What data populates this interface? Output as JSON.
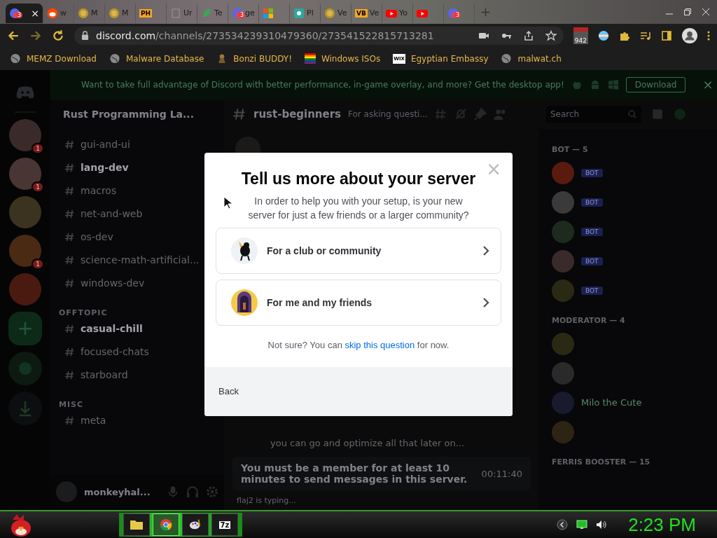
{
  "browser": {
    "tabs": [
      {
        "kind": "discord",
        "badge": "3",
        "selected": true,
        "close": "×"
      },
      {
        "kind": "reddit",
        "title": "w",
        "selected": false
      },
      {
        "kind": "coin",
        "title": "M",
        "selected": false
      },
      {
        "kind": "coin",
        "title": "M",
        "selected": false
      },
      {
        "kind": "label",
        "icon_text": "PH",
        "selected": false
      },
      {
        "kind": "plain",
        "title": "Ur",
        "selected": false
      },
      {
        "kind": "green",
        "title": "Te",
        "selected": false
      },
      {
        "kind": "discord",
        "badge": "3",
        "title": "ge",
        "selected": false
      },
      {
        "kind": "windows",
        "selected": false
      },
      {
        "kind": "teal",
        "title": "Pl",
        "selected": false
      },
      {
        "kind": "coin",
        "title": "Ve",
        "selected": false
      },
      {
        "kind": "label",
        "icon_text": "VB",
        "title": "Ve",
        "selected": false
      },
      {
        "kind": "youtube",
        "title": "Yo",
        "selected": false
      },
      {
        "kind": "youtube",
        "selected": false
      },
      {
        "kind": "discord",
        "badge": "3",
        "selected": false
      }
    ],
    "new_tab": "+",
    "address": {
      "host": "discord.com",
      "path": "/channels/273534239310479360/273541522815713281"
    },
    "extension_badge": "942",
    "bookmarks": [
      {
        "kind": "globe",
        "label": "MEMZ Download"
      },
      {
        "kind": "globe",
        "label": "Malware Database"
      },
      {
        "kind": "figure",
        "label": "Bonzi BUDDY!"
      },
      {
        "kind": "rainbow",
        "label": "Windows ISOs"
      },
      {
        "kind": "label",
        "icon_text": "WIX",
        "label": "Egyptian Embassy"
      },
      {
        "kind": "globe",
        "label": "malwat.ch"
      }
    ]
  },
  "discord": {
    "banner": {
      "text": "Want to take full advantage of Discord with better performance, in-game overlay, and more? Get the desktop app!",
      "button": "Download",
      "close": "×"
    },
    "servers": [
      {
        "color": "#3a2a2a",
        "badge": "1"
      },
      {
        "color": "#4a3535",
        "badge": "1"
      },
      {
        "color": "#3b3320"
      },
      {
        "color": "#4a2a12",
        "badge": "1"
      },
      {
        "color": "#4a1a10"
      }
    ],
    "add_server": "+",
    "server_name": "Rust Programming La...",
    "channels": [
      {
        "kind": "channel",
        "name": "gui-and-ui",
        "bold": false
      },
      {
        "kind": "channel",
        "name": "lang-dev",
        "bold": true
      },
      {
        "kind": "channel",
        "name": "macros",
        "bold": false
      },
      {
        "kind": "channel",
        "name": "net-and-web",
        "bold": false
      },
      {
        "kind": "channel",
        "name": "os-dev",
        "bold": false
      },
      {
        "kind": "channel",
        "name": "science-math-artificial...",
        "bold": false
      },
      {
        "kind": "channel",
        "name": "windows-dev",
        "bold": false
      },
      {
        "kind": "category",
        "name": "OFFTOPIC"
      },
      {
        "kind": "channel",
        "name": "casual-chill",
        "bold": true
      },
      {
        "kind": "channel",
        "name": "focused-chats",
        "bold": false
      },
      {
        "kind": "channel",
        "name": "starboard",
        "bold": false
      },
      {
        "kind": "category",
        "name": "MISC"
      },
      {
        "kind": "channel",
        "name": "meta",
        "bold": false
      }
    ],
    "user": {
      "name": "monkeyhal..."
    },
    "chat": {
      "channel": "rust-beginners",
      "topic": "For asking questi...",
      "search": {
        "placeholder": "Search"
      },
      "message": "you can go and optimize all that later on...",
      "notice": "You must be a member for at least 10 minutes to send messages in this server.",
      "timer": "00:11:40",
      "typing": "flaj2 is typing..."
    },
    "member_groups": [
      {
        "title": "BOT — 5",
        "members": [
          {
            "color": "#5a1a10",
            "tag": "BOT"
          },
          {
            "color": "#3a3a3a",
            "tag": "BOT"
          },
          {
            "color": "#1e2a1e",
            "tag": "BOT"
          },
          {
            "color": "#3a2a2a",
            "tag": "BOT"
          },
          {
            "color": "#2a2a14",
            "tag": "BOT"
          }
        ]
      },
      {
        "title": "MODERATOR — 4",
        "members": [
          {
            "color": "#2a2a14"
          },
          {
            "color": "#2a2a2a"
          },
          {
            "color": "#1a1a2e",
            "name": "Milo the Cute"
          },
          {
            "color": "#2e2414"
          }
        ]
      },
      {
        "title": "FERRIS BOOSTER — 15"
      }
    ]
  },
  "modal": {
    "title": "Tell us more about your server",
    "description": "In order to help you with your setup, is your new server for just a few friends or a larger community?",
    "options": [
      {
        "kind": "club",
        "label": "For a club or community"
      },
      {
        "kind": "friends",
        "label": "For me and my friends"
      }
    ],
    "hint_before": "Not sure? You can",
    "hint_link": "skip this question",
    "hint_after": "for now.",
    "back": "Back",
    "close": "×"
  },
  "taskbar": {
    "apps": [
      {
        "kind": "folder",
        "selected": false
      },
      {
        "kind": "chrome",
        "selected": true
      },
      {
        "kind": "paint",
        "selected": false
      },
      {
        "kind": "label",
        "icon_text": "7z",
        "selected": false
      }
    ],
    "clock": "2:23 PM"
  }
}
